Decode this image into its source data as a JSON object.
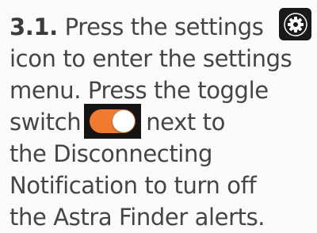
{
  "step_number": "3.1.",
  "lines": {
    "l1": "Press the settings",
    "l2": "icon to enter the settings",
    "l3": "menu. Press the toggle",
    "l4a": "switch",
    "l4b": "next to",
    "l5": "the Disconnecting",
    "l6": "Notification to turn off",
    "l7": "the Astra Finder alerts."
  },
  "icons": {
    "settings": "gear-icon",
    "toggle": "toggle-switch-on"
  },
  "colors": {
    "text": "#454545",
    "toggle_on": "#f07a2e",
    "icon_bg": "#1a1a1a",
    "background": "#fbfbfa"
  }
}
